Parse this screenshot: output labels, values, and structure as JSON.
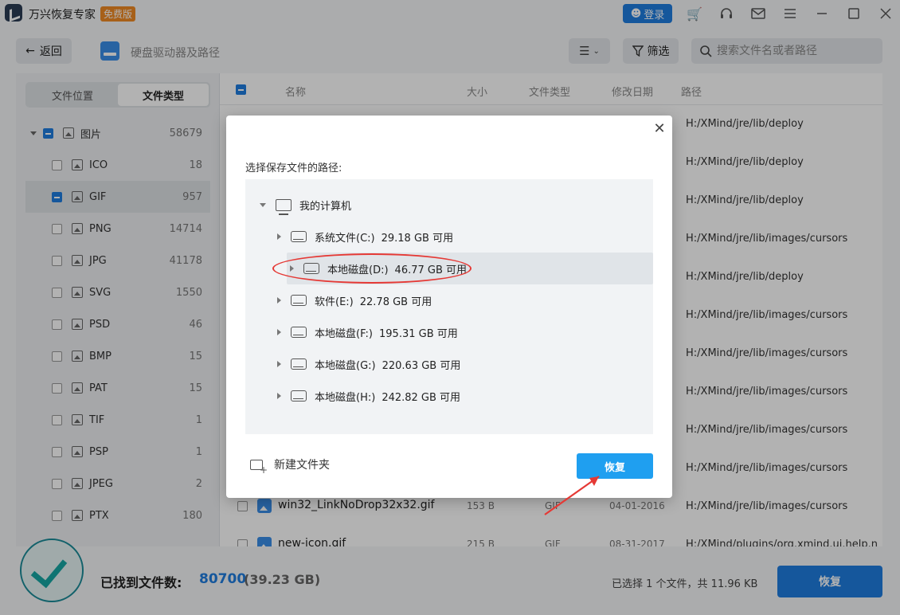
{
  "app": {
    "title": "万兴恢复专家",
    "badge": "免费版",
    "login_label": "登录"
  },
  "toolbar": {
    "back_label": "返回",
    "breadcrumb": "硬盘驱动器及路径",
    "filter_label": "筛选",
    "search_placeholder": "搜索文件名或者路径"
  },
  "sidebar": {
    "tabs": [
      "文件位置",
      "文件类型"
    ],
    "root": {
      "label": "图片",
      "count": "58679"
    },
    "items": [
      {
        "label": "ICO",
        "count": "18"
      },
      {
        "label": "GIF",
        "count": "957"
      },
      {
        "label": "PNG",
        "count": "14714"
      },
      {
        "label": "JPG",
        "count": "41178"
      },
      {
        "label": "SVG",
        "count": "1550"
      },
      {
        "label": "PSD",
        "count": "46"
      },
      {
        "label": "BMP",
        "count": "15"
      },
      {
        "label": "PAT",
        "count": "15"
      },
      {
        "label": "TIF",
        "count": "1"
      },
      {
        "label": "PSP",
        "count": "1"
      },
      {
        "label": "JPEG",
        "count": "2"
      },
      {
        "label": "PTX",
        "count": "180"
      }
    ]
  },
  "table": {
    "columns": [
      "名称",
      "大小",
      "文件类型",
      "修改日期",
      "路径"
    ],
    "paths": [
      "H:/XMind/jre/lib/deploy",
      "H:/XMind/jre/lib/deploy",
      "H:/XMind/jre/lib/deploy",
      "H:/XMind/jre/lib/images/cursors",
      "H:/XMind/jre/lib/deploy",
      "H:/XMind/jre/lib/images/cursors",
      "H:/XMind/jre/lib/images/cursors",
      "H:/XMind/jre/lib/images/cursors",
      "H:/XMind/jre/lib/images/cursors",
      "H:/XMind/jre/lib/images/cursors"
    ],
    "visible_rows": [
      {
        "name": "win32_LinkNoDrop32x32.gif",
        "size": "153 B",
        "type": "GIF",
        "date": "04-01-2016",
        "path": "H:/XMind/jre/lib/images/cursors"
      },
      {
        "name": "new-icon.gif",
        "size": "215 B",
        "type": "GIF",
        "date": "08-31-2017",
        "path": "H:/XMind/plugins/org.xmind.ui.help.n"
      }
    ]
  },
  "footer": {
    "found_label": "已找到文件数:",
    "found_count": "80700",
    "found_size": "(39.23 GB)",
    "selected_summary": "已选择 1 个文件，共 11.96 KB",
    "recover_label": "恢复"
  },
  "dialog": {
    "label": "选择保存文件的路径:",
    "root": "我的计算机",
    "drives": [
      {
        "name": "系统文件(C:)",
        "free": "29.18 GB 可用"
      },
      {
        "name": "本地磁盘(D:)",
        "free": "46.77 GB 可用"
      },
      {
        "name": "软件(E:)",
        "free": "22.78 GB 可用"
      },
      {
        "name": "本地磁盘(F:)",
        "free": "195.31 GB 可用"
      },
      {
        "name": "本地磁盘(G:)",
        "free": "220.63 GB 可用"
      },
      {
        "name": "本地磁盘(H:)",
        "free": "242.82 GB 可用"
      }
    ],
    "new_folder_label": "新建文件夹",
    "recover_label": "恢复"
  },
  "colors": {
    "accent": "#1f7de0",
    "dialog_button": "#1f9ff0",
    "annotation": "#e53935",
    "badge": "#f08a24"
  }
}
